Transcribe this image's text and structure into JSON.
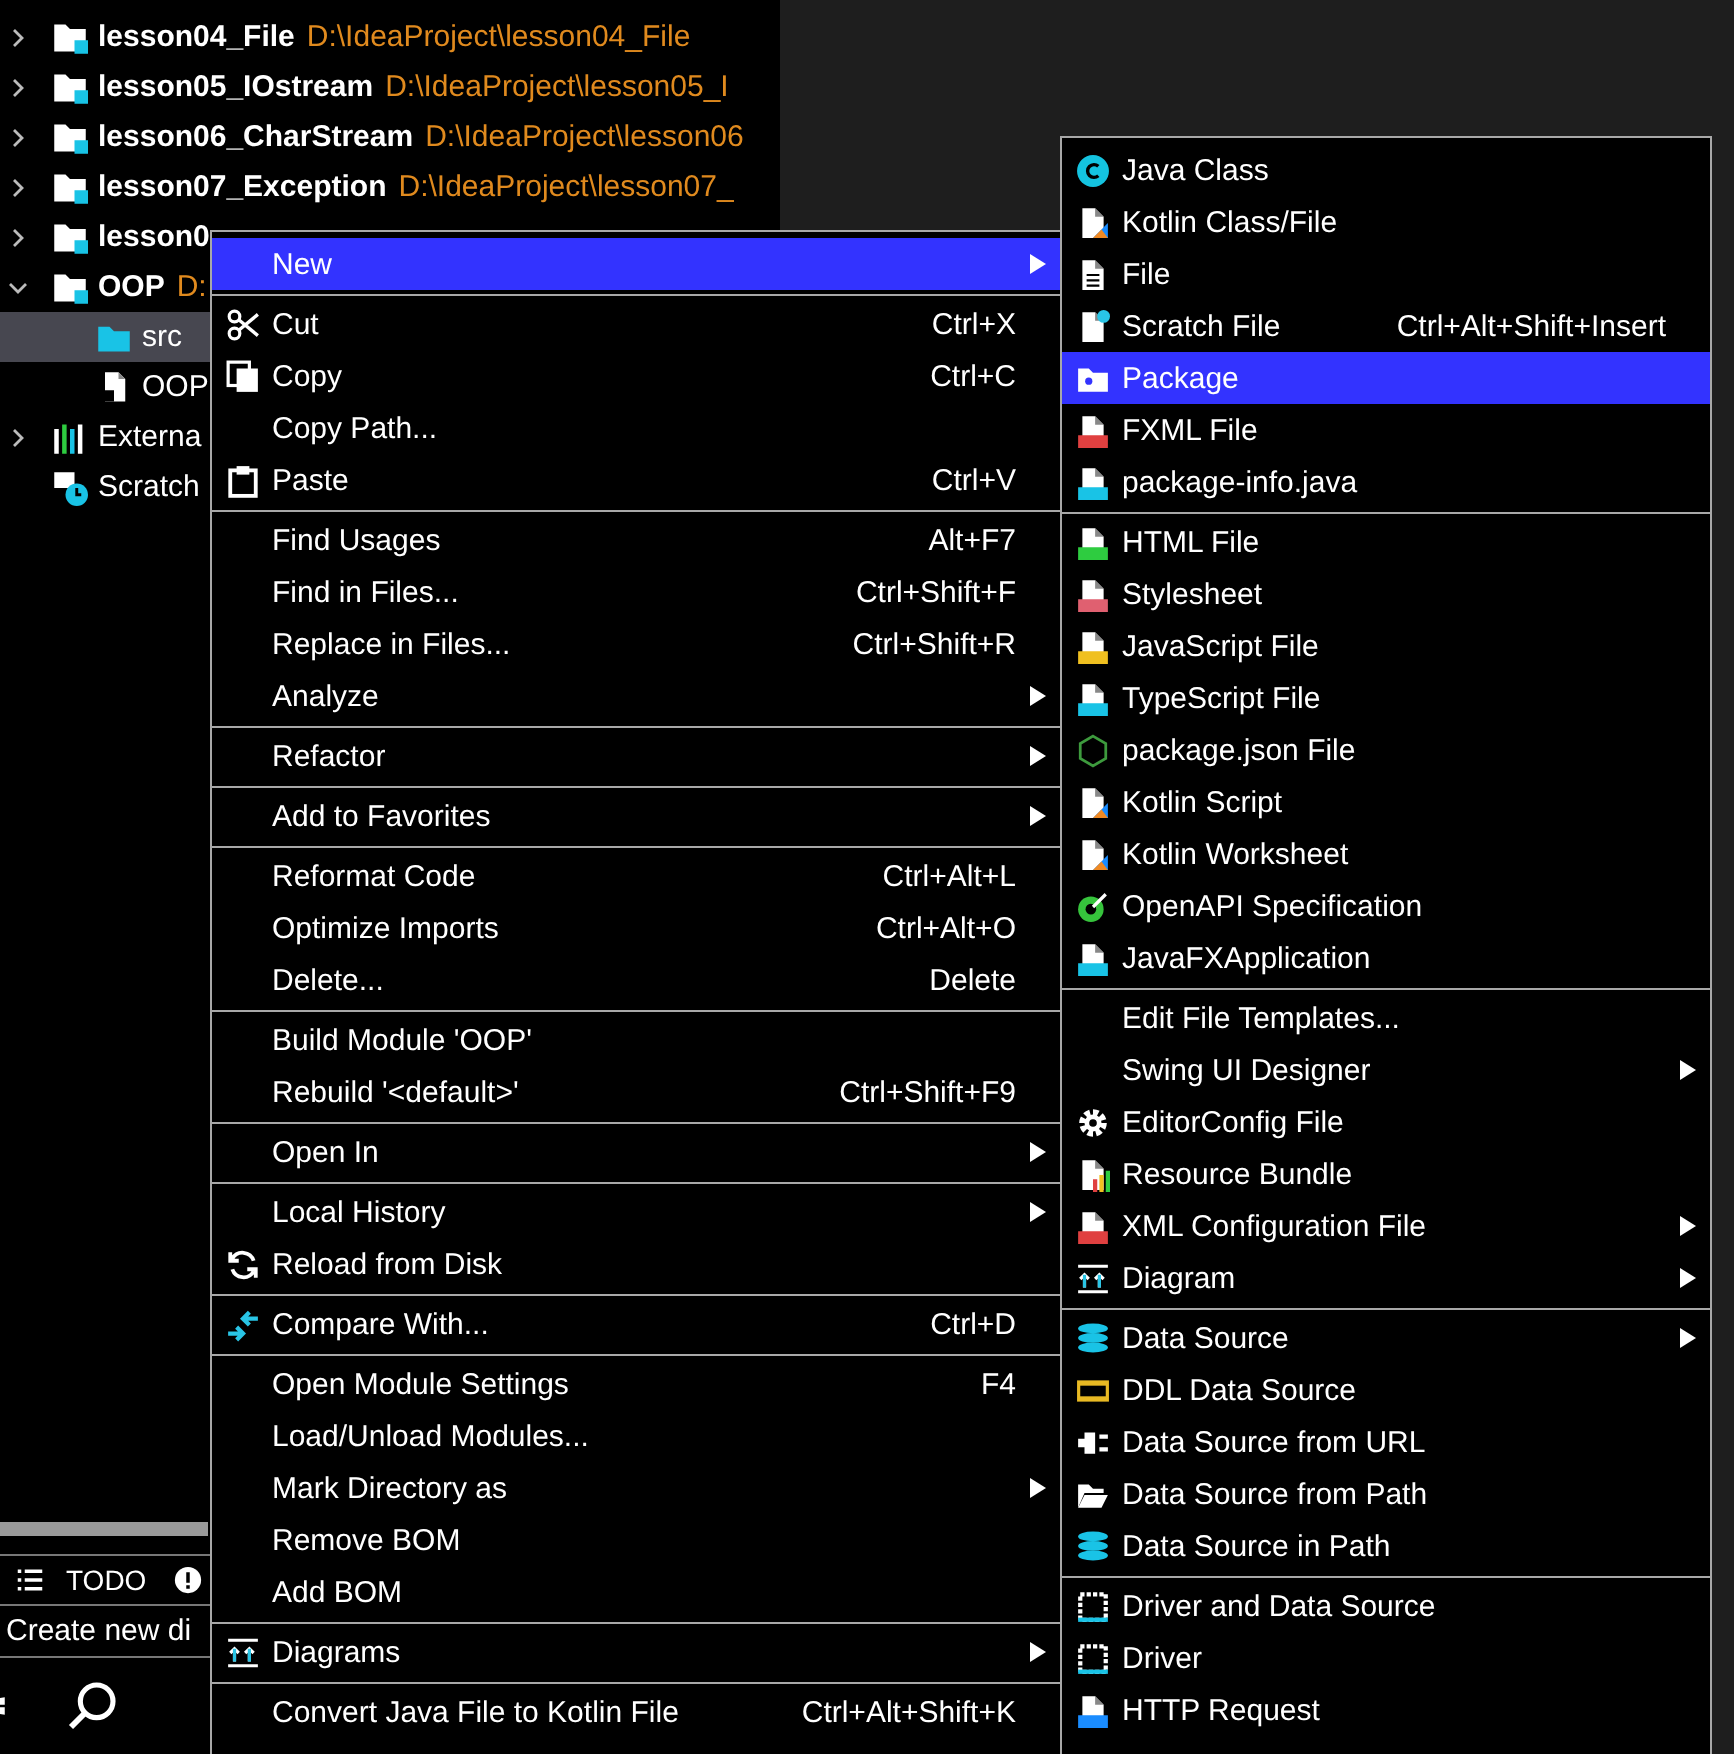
{
  "tree": [
    {
      "kind": "module",
      "name": "lesson04_File",
      "path": "D:\\IdeaProject\\lesson04_File",
      "expanded": false,
      "selected": false
    },
    {
      "kind": "module",
      "name": "lesson05_IOstream",
      "path": "D:\\IdeaProject\\lesson05_I",
      "expanded": false,
      "selected": false
    },
    {
      "kind": "module",
      "name": "lesson06_CharStream",
      "path": "D:\\IdeaProject\\lesson06",
      "expanded": false,
      "selected": false
    },
    {
      "kind": "module",
      "name": "lesson07_Exception",
      "path": "D:\\IdeaProject\\lesson07_",
      "expanded": false,
      "selected": false
    },
    {
      "kind": "module",
      "name": "lesson0",
      "expanded": false,
      "selected": false
    },
    {
      "kind": "module",
      "name": "OOP",
      "path": "D:",
      "expanded": true,
      "selected": false,
      "children": [
        {
          "kind": "folder",
          "name": "src",
          "selected": true
        },
        {
          "kind": "file",
          "name": "OOP",
          "selected": false
        }
      ]
    },
    {
      "kind": "libraries",
      "name": "Externa",
      "expanded": false,
      "selected": false
    },
    {
      "kind": "scratches",
      "name": "Scratch",
      "selected": false
    }
  ],
  "tool_tabs": [
    {
      "label": "TODO"
    }
  ],
  "status_bar": "Create new di",
  "menu": {
    "groups": [
      {
        "items": [
          {
            "label": "New",
            "submenu": true,
            "selected": true
          }
        ]
      },
      {
        "items": [
          {
            "label": "Cut",
            "shortcut": "Ctrl+X",
            "submenu": false,
            "selected": false
          },
          {
            "label": "Copy",
            "shortcut": "Ctrl+C",
            "submenu": false,
            "selected": false
          },
          {
            "label": "Copy Path...",
            "submenu": false,
            "selected": false
          },
          {
            "label": "Paste",
            "shortcut": "Ctrl+V",
            "submenu": false,
            "selected": false
          }
        ]
      },
      {
        "items": [
          {
            "label": "Find Usages",
            "shortcut": "Alt+F7",
            "submenu": false,
            "selected": false
          },
          {
            "label": "Find in Files...",
            "shortcut": "Ctrl+Shift+F",
            "submenu": false,
            "selected": false
          },
          {
            "label": "Replace in Files...",
            "shortcut": "Ctrl+Shift+R",
            "submenu": false,
            "selected": false
          },
          {
            "label": "Analyze",
            "submenu": true,
            "selected": false
          }
        ]
      },
      {
        "items": [
          {
            "label": "Refactor",
            "submenu": true,
            "selected": false
          }
        ]
      },
      {
        "items": [
          {
            "label": "Add to Favorites",
            "submenu": true,
            "selected": false
          }
        ]
      },
      {
        "items": [
          {
            "label": "Reformat Code",
            "shortcut": "Ctrl+Alt+L",
            "submenu": false,
            "selected": false
          },
          {
            "label": "Optimize Imports",
            "shortcut": "Ctrl+Alt+O",
            "submenu": false,
            "selected": false
          },
          {
            "label": "Delete...",
            "shortcut": "Delete",
            "submenu": false,
            "selected": false
          }
        ]
      },
      {
        "items": [
          {
            "label": "Build Module 'OOP'",
            "submenu": false,
            "selected": false
          },
          {
            "label": "Rebuild '<default>'",
            "shortcut": "Ctrl+Shift+F9",
            "submenu": false,
            "selected": false
          }
        ]
      },
      {
        "items": [
          {
            "label": "Open In",
            "submenu": true,
            "selected": false
          }
        ]
      },
      {
        "items": [
          {
            "label": "Local History",
            "submenu": true,
            "selected": false
          },
          {
            "label": "Reload from Disk",
            "submenu": false,
            "selected": false
          }
        ]
      },
      {
        "items": [
          {
            "label": "Compare With...",
            "shortcut": "Ctrl+D",
            "submenu": false,
            "selected": false
          }
        ]
      },
      {
        "items": [
          {
            "label": "Open Module Settings",
            "shortcut": "F4",
            "submenu": false,
            "selected": false
          },
          {
            "label": "Load/Unload Modules...",
            "submenu": false,
            "selected": false
          },
          {
            "label": "Mark Directory as",
            "submenu": true,
            "selected": false
          },
          {
            "label": "Remove BOM",
            "submenu": false,
            "selected": false
          },
          {
            "label": "Add BOM",
            "submenu": false,
            "selected": false
          }
        ]
      },
      {
        "items": [
          {
            "label": "Diagrams",
            "submenu": true,
            "selected": false
          }
        ]
      },
      {
        "items": [
          {
            "label": "Convert Java File to Kotlin File",
            "shortcut": "Ctrl+Alt+Shift+K",
            "submenu": false,
            "selected": false
          }
        ]
      }
    ]
  },
  "submenu": {
    "groups": [
      {
        "items": [
          {
            "label": "Java Class",
            "submenu": false,
            "selected": false
          },
          {
            "label": "Kotlin Class/File",
            "submenu": false,
            "selected": false
          },
          {
            "label": "File",
            "submenu": false,
            "selected": false
          },
          {
            "label": "Scratch File",
            "shortcut": "Ctrl+Alt+Shift+Insert",
            "submenu": false,
            "selected": false
          },
          {
            "label": "Package",
            "submenu": false,
            "selected": true
          },
          {
            "label": "FXML File",
            "submenu": false,
            "selected": false
          },
          {
            "label": "package-info.java",
            "submenu": false,
            "selected": false
          }
        ]
      },
      {
        "items": [
          {
            "label": "HTML File",
            "submenu": false,
            "selected": false
          },
          {
            "label": "Stylesheet",
            "submenu": false,
            "selected": false
          },
          {
            "label": "JavaScript File",
            "submenu": false,
            "selected": false
          },
          {
            "label": "TypeScript File",
            "submenu": false,
            "selected": false
          },
          {
            "label": "package.json File",
            "submenu": false,
            "selected": false
          },
          {
            "label": "Kotlin Script",
            "submenu": false,
            "selected": false
          },
          {
            "label": "Kotlin Worksheet",
            "submenu": false,
            "selected": false
          },
          {
            "label": "OpenAPI Specification",
            "submenu": false,
            "selected": false
          },
          {
            "label": "JavaFXApplication",
            "submenu": false,
            "selected": false
          }
        ]
      },
      {
        "items": [
          {
            "label": "Edit File Templates...",
            "submenu": false,
            "selected": false
          },
          {
            "label": "Swing UI Designer",
            "submenu": true,
            "selected": false
          },
          {
            "label": "EditorConfig File",
            "submenu": false,
            "selected": false
          },
          {
            "label": "Resource Bundle",
            "submenu": false,
            "selected": false
          },
          {
            "label": "XML Configuration File",
            "submenu": true,
            "selected": false
          },
          {
            "label": "Diagram",
            "submenu": true,
            "selected": false
          }
        ]
      },
      {
        "items": [
          {
            "label": "Data Source",
            "submenu": true,
            "selected": false
          },
          {
            "label": "DDL Data Source",
            "submenu": false,
            "selected": false
          },
          {
            "label": "Data Source from URL",
            "submenu": false,
            "selected": false
          },
          {
            "label": "Data Source from Path",
            "submenu": false,
            "selected": false
          },
          {
            "label": "Data Source in Path",
            "submenu": false,
            "selected": false
          }
        ]
      },
      {
        "items": [
          {
            "label": "Driver and Data Source",
            "submenu": false,
            "selected": false
          },
          {
            "label": "Driver",
            "submenu": false,
            "selected": false
          },
          {
            "label": "HTTP Request",
            "submenu": false,
            "selected": false
          }
        ]
      }
    ]
  }
}
